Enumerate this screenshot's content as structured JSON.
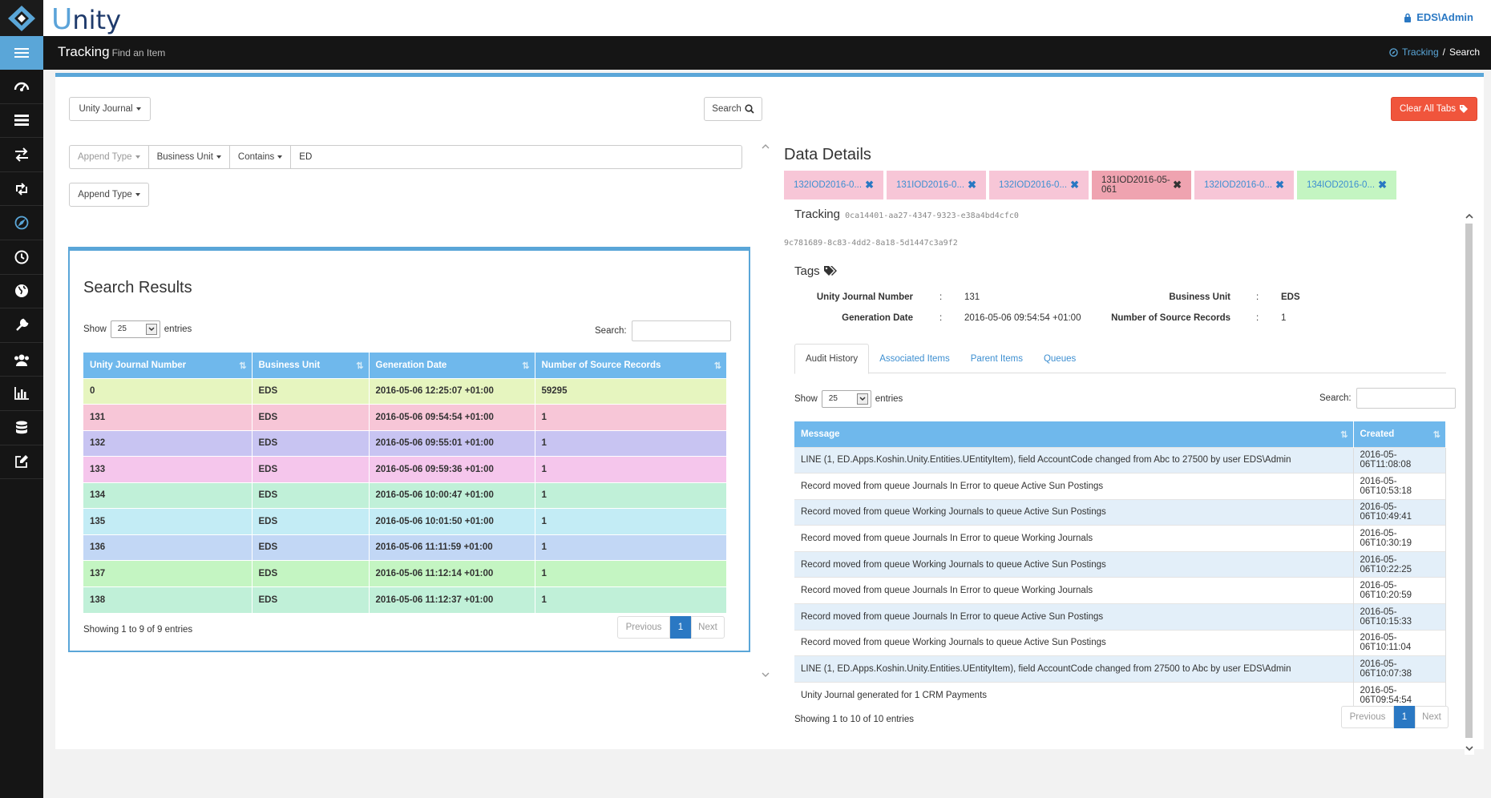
{
  "app": {
    "brand_first": "U",
    "brand_rest": "nity",
    "user": "EDS\\Admin"
  },
  "titlebar": {
    "title": "Tracking",
    "subtitle": "Find an Item",
    "breadcrumb": [
      "Tracking",
      "/",
      "Search"
    ]
  },
  "sidebar": {
    "items": [
      "dashboard-icon",
      "list-icon",
      "transfer-icon",
      "retweet-icon",
      "compass-icon",
      "clock-icon",
      "globe-icon",
      "wrench-icon",
      "users-icon",
      "bar-chart-icon",
      "database-icon",
      "edit-icon"
    ],
    "active_index": 4
  },
  "toolbar": {
    "journal_dropdown": "Unity Journal",
    "search_button": "Search",
    "clear_tabs_button": "Clear All Tabs"
  },
  "filters": {
    "append_type": "Append Type",
    "business_unit": "Business Unit",
    "contains": "Contains",
    "value": "ED",
    "append_type_2": "Append Type"
  },
  "search_results": {
    "title": "Search Results",
    "show_label": "Show",
    "entries_label": "entries",
    "page_size": "25",
    "search_label": "Search:",
    "columns": [
      "Unity Journal Number",
      "Business Unit",
      "Generation Date",
      "Number of Source Records"
    ],
    "rows": [
      {
        "journal": "0",
        "unit": "EDS",
        "date": "2016-05-06 12:25:07 +01:00",
        "records": "59295",
        "color": "#e6f5bf"
      },
      {
        "journal": "131",
        "unit": "EDS",
        "date": "2016-05-06 09:54:54 +01:00",
        "records": "1",
        "color": "#f7c6d7"
      },
      {
        "journal": "132",
        "unit": "EDS",
        "date": "2016-05-06 09:55:01 +01:00",
        "records": "1",
        "color": "#c8c4f2"
      },
      {
        "journal": "133",
        "unit": "EDS",
        "date": "2016-05-06 09:59:36 +01:00",
        "records": "1",
        "color": "#f5c6ec"
      },
      {
        "journal": "134",
        "unit": "EDS",
        "date": "2016-05-06 10:00:47 +01:00",
        "records": "1",
        "color": "#c0f0d8"
      },
      {
        "journal": "135",
        "unit": "EDS",
        "date": "2016-05-06 10:01:50 +01:00",
        "records": "1",
        "color": "#c3ecf5"
      },
      {
        "journal": "136",
        "unit": "EDS",
        "date": "2016-05-06 11:11:59 +01:00",
        "records": "1",
        "color": "#c2d7f5"
      },
      {
        "journal": "137",
        "unit": "EDS",
        "date": "2016-05-06 11:12:14 +01:00",
        "records": "1",
        "color": "#c4f5c2"
      },
      {
        "journal": "138",
        "unit": "EDS",
        "date": "2016-05-06 11:12:37 +01:00",
        "records": "1",
        "color": "#c0f0d8"
      }
    ],
    "info": "Showing 1 to 9 of 9 entries",
    "pager": {
      "previous": "Previous",
      "current": "1",
      "next": "Next"
    }
  },
  "data_details": {
    "title": "Data Details",
    "tabs": [
      {
        "label": "132IOD2016-0...",
        "color": "#f7c6d7",
        "active": false
      },
      {
        "label": "131IOD2016-0...",
        "color": "#f7c6d7",
        "active": false
      },
      {
        "label": "132IOD2016-0...",
        "color": "#f7c6d7",
        "active": false
      },
      {
        "label": "131IOD2016-05-061",
        "color": "#efa3b0",
        "active": true
      },
      {
        "label": "132IOD2016-0...",
        "color": "#f7c6d7",
        "active": false
      },
      {
        "label": "134IOD2016-0...",
        "color": "#c4f5c2",
        "active": false
      }
    ],
    "tracking_label": "Tracking",
    "tracking_id": "0ca14401-aa27-4347-9323-e38a4bd4cfc0",
    "secondary_id": "9c781689-8c83-4dd2-8a18-5d1447c3a9f2",
    "tags_label": "Tags",
    "fields": {
      "journal_label": "Unity Journal Number",
      "journal_value": "131",
      "gen_label": "Generation Date",
      "gen_value": "2016-05-06 09:54:54 +01:00",
      "bu_label": "Business Unit",
      "bu_value": "EDS",
      "nsr_label": "Number of Source Records",
      "nsr_value": "1",
      "sep": ":"
    },
    "inner_tabs": [
      "Audit History",
      "Associated Items",
      "Parent Items",
      "Queues"
    ],
    "audit": {
      "show_label": "Show",
      "entries_label": "entries",
      "page_size": "25",
      "search_label": "Search:",
      "columns": [
        "Message",
        "Created"
      ],
      "rows": [
        {
          "message": "LINE (1, ED.Apps.Koshin.Unity.Entities.UEntityItem), field AccountCode changed from Abc to 27500 by user EDS\\Admin",
          "created": "2016-05-06T11:08:08"
        },
        {
          "message": "Record moved from queue Journals In Error to queue Active Sun Postings",
          "created": "2016-05-06T10:53:18"
        },
        {
          "message": "Record moved from queue Working Journals to queue Active Sun Postings",
          "created": "2016-05-06T10:49:41"
        },
        {
          "message": "Record moved from queue Journals In Error to queue Working Journals",
          "created": "2016-05-06T10:30:19"
        },
        {
          "message": "Record moved from queue Working Journals to queue Active Sun Postings",
          "created": "2016-05-06T10:22:25"
        },
        {
          "message": "Record moved from queue Journals In Error to queue Working Journals",
          "created": "2016-05-06T10:20:59"
        },
        {
          "message": "Record moved from queue Journals In Error to queue Active Sun Postings",
          "created": "2016-05-06T10:15:33"
        },
        {
          "message": "Record moved from queue Working Journals to queue Active Sun Postings",
          "created": "2016-05-06T10:11:04"
        },
        {
          "message": "LINE (1, ED.Apps.Koshin.Unity.Entities.UEntityItem), field AccountCode changed from 27500 to Abc by user EDS\\Admin",
          "created": "2016-05-06T10:07:38"
        },
        {
          "message": "Unity Journal generated for 1 CRM Payments",
          "created": "2016-05-06T09:54:54"
        }
      ],
      "info": "Showing 1 to 10 of 10 entries",
      "pager": {
        "previous": "Previous",
        "current": "1",
        "next": "Next"
      }
    }
  },
  "colors": {
    "accent": "#5aa6d8",
    "header_dark": "#151515",
    "danger": "#f0553c",
    "table_header": "#6fb8ec"
  }
}
